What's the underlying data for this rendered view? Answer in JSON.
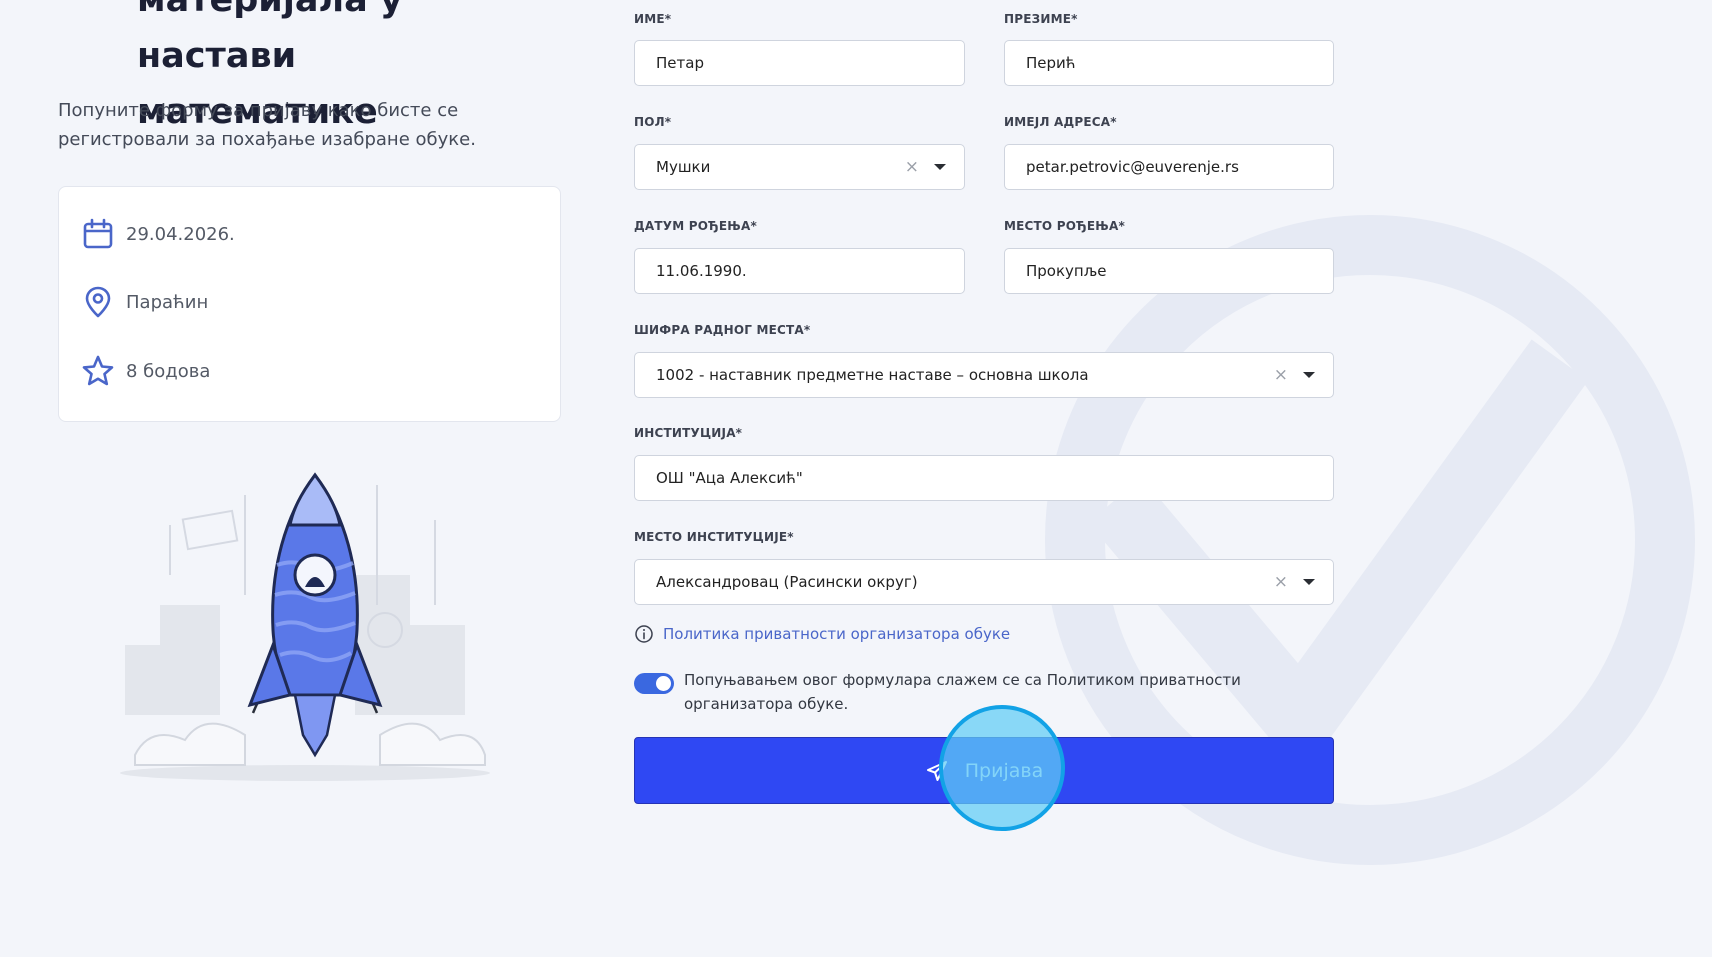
{
  "page": {
    "title_lines": [
      "материјала у настави",
      "математике"
    ],
    "intro": "Попуните форму за пријаву како бисте се регистровали за похађање изабране обуке."
  },
  "info": {
    "date": "29.04.2026.",
    "location": "Параћин",
    "points": "8 бодова"
  },
  "form": {
    "first_name": {
      "label": "ИМЕ*",
      "value": "Петар"
    },
    "last_name": {
      "label": "ПРЕЗИМЕ*",
      "value": "Перић"
    },
    "gender": {
      "label": "ПОЛ*",
      "value": "Мушки"
    },
    "email": {
      "label": "ИМЕЈЛ АДРЕСА*",
      "value": "petar.petrovic@euverenje.rs"
    },
    "birth_date": {
      "label": "ДАТУМ РОЂЕЊА*",
      "value": "11.06.1990."
    },
    "birth_place": {
      "label": "МЕСТО РОЂЕЊА*",
      "value": "Прокупље"
    },
    "job_code": {
      "label": "ШИФРА РАДНОГ МЕСТА*",
      "value": "1002 - наставник предметне наставе – основна школа"
    },
    "institution": {
      "label": "ИНСТИТУЦИЈА*",
      "value": "ОШ \"Аца Алексић\""
    },
    "institution_place": {
      "label": "МЕСТО ИНСТИТУЦИЈЕ*",
      "value": "Александровац (Расински округ)"
    },
    "clear_symbol": "×"
  },
  "privacy": {
    "link_text": "Политика приватности организатора обуке",
    "consent_text": "Попуњавањем овог формулара слажем се са Политиком приватности организатора обуке.",
    "consent_checked": true
  },
  "submit": {
    "label": "Пријава"
  },
  "colors": {
    "accent": "#2f48f3",
    "toggle": "#3a68e0",
    "icon": "#4a66c9",
    "click_indicator": "#12a2e6"
  }
}
